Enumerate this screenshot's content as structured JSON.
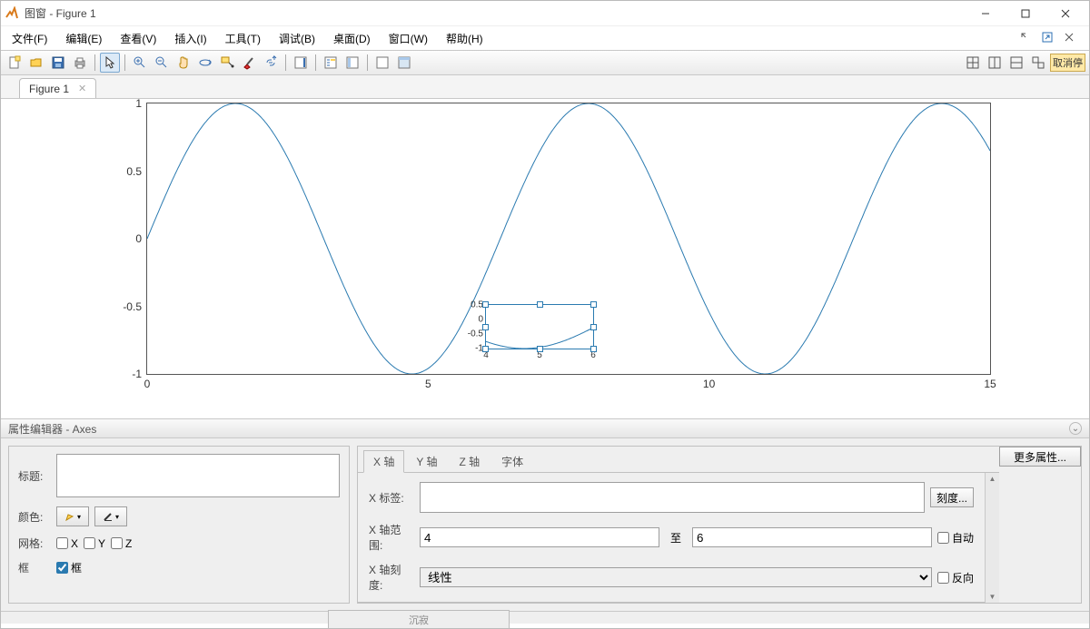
{
  "window_title": "图窗 - Figure 1",
  "menu": {
    "file": "文件(F)",
    "edit": "编辑(E)",
    "view": "查看(V)",
    "insert": "插入(I)",
    "tools": "工具(T)",
    "debug": "调试(B)",
    "desktop": "桌面(D)",
    "window": "窗口(W)",
    "help": "帮助(H)"
  },
  "tab_label": "Figure 1",
  "toolbar_cancel": "取消停",
  "prop_header": "属性编辑器 - Axes",
  "left": {
    "title_lbl": "标题:",
    "title_val": "",
    "color_lbl": "颜色:",
    "grid_lbl": "网格:",
    "gx": "X",
    "gy": "Y",
    "gz": "Z",
    "frame_lbl": "框",
    "frame_chk": "框"
  },
  "right": {
    "tab_x": "X 轴",
    "tab_y": "Y 轴",
    "tab_z": "Z 轴",
    "tab_font": "字体",
    "xlabel_lbl": "X 标签:",
    "xlabel_val": "",
    "xrange_lbl": "X 轴范围:",
    "xmin": "4",
    "to": "至",
    "xmax": "6",
    "auto": "自动",
    "xscale_lbl": "X 轴刻度:",
    "scale_val": "线性",
    "reverse": "反向",
    "ticks_btn": "刻度...",
    "more": "更多属性..."
  },
  "footer_text": "沉寂",
  "chart_data": {
    "type": "line",
    "function": "sin(x)",
    "xlim": [
      0,
      15
    ],
    "ylim": [
      -1,
      1
    ],
    "x_ticks": [
      0,
      5,
      10,
      15
    ],
    "y_ticks": [
      -1,
      -0.5,
      0,
      0.5,
      1
    ],
    "inset": {
      "selected": true,
      "xlim": [
        4,
        6
      ],
      "ylim": [
        -1,
        0.5
      ],
      "x_ticks": [
        4,
        5,
        6
      ],
      "y_ticks": [
        -1,
        -0.5,
        0,
        0.5
      ]
    }
  }
}
